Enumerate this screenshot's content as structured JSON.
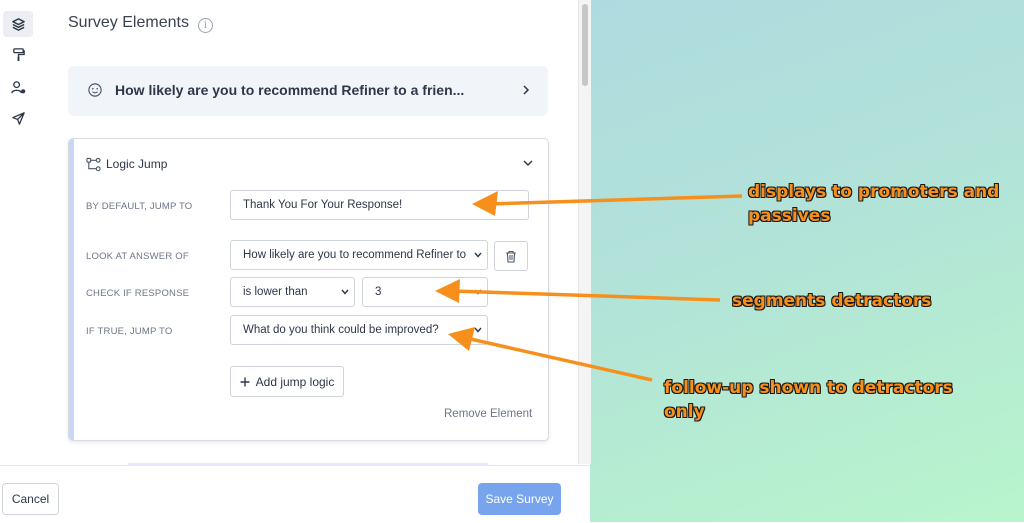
{
  "sidebar": {
    "icons": [
      "layers-icon",
      "paint-roller-icon",
      "user-settings-icon",
      "send-icon"
    ]
  },
  "panel": {
    "title": "Survey Elements"
  },
  "question_card": {
    "text": "How likely are you to recommend Refiner to a frien..."
  },
  "logic_jump": {
    "title": "Logic Jump",
    "default_label": "BY DEFAULT, JUMP TO",
    "default_value": "Thank You For Your Response!",
    "look_label": "LOOK AT ANSWER OF",
    "look_value": "How likely are you to recommend Refiner to",
    "check_label": "CHECK IF RESPONSE",
    "check_operator": "is lower than",
    "check_value": "3",
    "true_label": "IF TRUE, JUMP TO",
    "true_value": "What do you think could be improved?",
    "add_label": "Add jump logic",
    "remove_label": "Remove Element"
  },
  "footer": {
    "cancel_label": "Cancel",
    "save_label": "Save Survey"
  },
  "annotations": {
    "a1_line1": "displays to promoters and",
    "a1_line2": "passives",
    "a2": "segments detractors",
    "a3_line1": "follow-up shown to detractors",
    "a3_line2": "only"
  },
  "colors": {
    "accent": "#78a4ee",
    "annotation": "#f68f1c",
    "card_bg": "#f1f5fa"
  }
}
